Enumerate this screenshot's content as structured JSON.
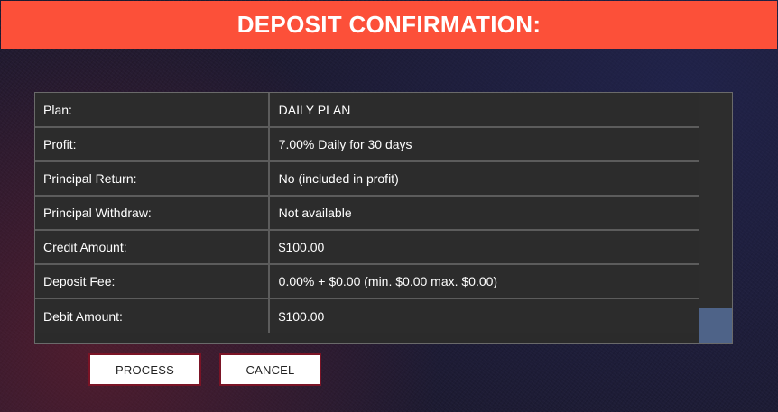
{
  "header": {
    "title": "DEPOSIT CONFIRMATION:"
  },
  "details": {
    "rows": [
      {
        "label": "Plan:",
        "value": "DAILY PLAN"
      },
      {
        "label": "Profit:",
        "value": "7.00% Daily for 30 days"
      },
      {
        "label": "Principal Return:",
        "value": "No (included in profit)"
      },
      {
        "label": "Principal Withdraw:",
        "value": "Not available"
      },
      {
        "label": "Credit Amount:",
        "value": "$100.00"
      },
      {
        "label": "Deposit Fee:",
        "value": "0.00% + $0.00 (min. $0.00 max. $0.00)"
      },
      {
        "label": "Debit Amount:",
        "value": "$100.00"
      }
    ]
  },
  "actions": {
    "process_label": "PROCESS",
    "cancel_label": "CANCEL"
  },
  "colors": {
    "header_bg": "#fc5039",
    "table_bg": "#2c2c2c",
    "scroll_thumb": "#4e6388",
    "button_border": "#7b1426"
  }
}
